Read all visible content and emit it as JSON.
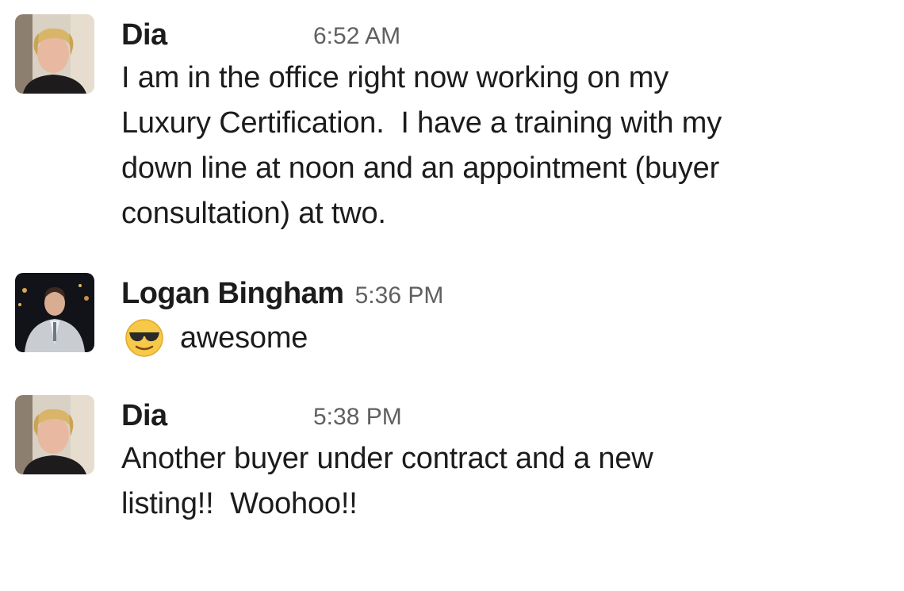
{
  "messages": [
    {
      "author": "Dia",
      "time": "6:52 AM",
      "avatar": "dia-avatar",
      "lines": [
        "I am in the office right now working on my",
        "Luxury Certification.  I have a training with my",
        "down line at noon and an appointment (buyer",
        "consultation) at two."
      ]
    },
    {
      "author": "Logan Bingham",
      "time": "5:36 PM",
      "avatar": "logan-avatar",
      "emoji": "sunglasses-smiley-emoji",
      "text": "awesome"
    },
    {
      "author": "Dia",
      "time": "5:38 PM",
      "avatar": "dia-avatar",
      "lines": [
        "Another buyer under contract and a new",
        "listing!!  Woohoo!!"
      ]
    }
  ]
}
